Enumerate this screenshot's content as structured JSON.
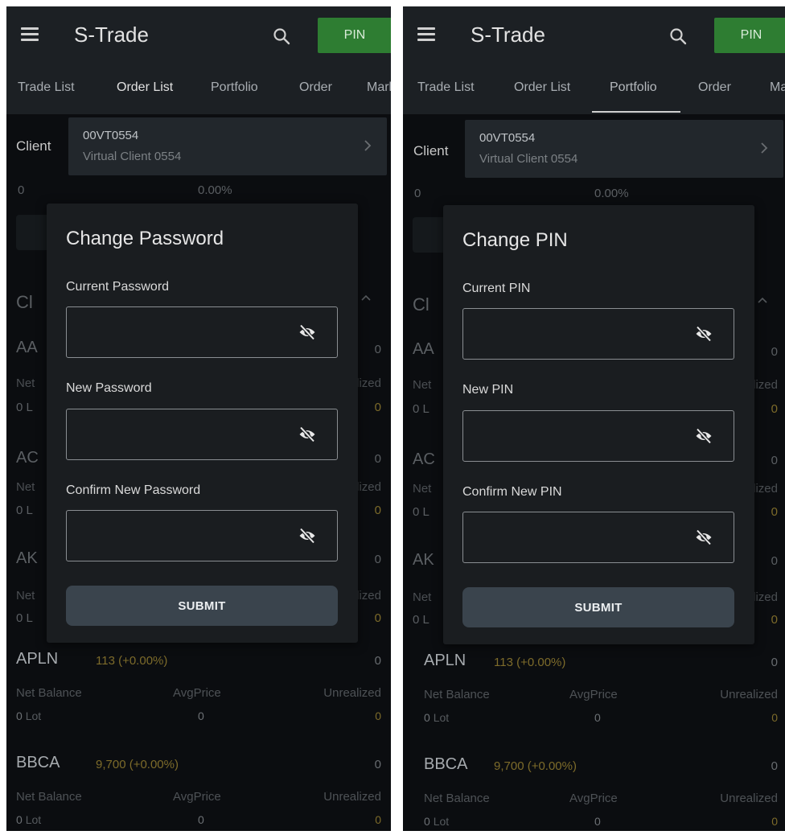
{
  "app": {
    "title": "S-Trade",
    "pin_label": "PIN",
    "menu_icon": "hamburger-menu-icon",
    "search_icon": "search-icon",
    "accent_green": "#2e7d32"
  },
  "tabs": [
    {
      "label": "Trade List"
    },
    {
      "label": "Order List"
    },
    {
      "label": "Portfolio"
    },
    {
      "label": "Order"
    },
    {
      "label": "Mark"
    }
  ],
  "tabs_right_last": "Ma",
  "client": {
    "label": "Client",
    "code": "00VT0554",
    "name": "Virtual Client 0554"
  },
  "background": {
    "summary_left": "0",
    "summary_pct": "0.00%",
    "section_initial": "Cl",
    "stocks": [
      {
        "sym": "AA",
        "right": "0",
        "col_a": "Net",
        "col_c": "Unrealized",
        "lot": "0 L",
        "unreal": "0"
      },
      {
        "sym": "AC",
        "right": "0",
        "col_a": "Net",
        "col_c": "Unrealized",
        "lot": "0 L",
        "unreal": "0"
      },
      {
        "sym": "AK",
        "right": "0",
        "col_a": "Net",
        "col_c": "Unrealized",
        "lot": "0 L",
        "unreal": "0"
      }
    ],
    "full_stocks": [
      {
        "sym": "APLN",
        "price": "113 (+0.00%)",
        "right": "0",
        "lbl_a": "Net Balance",
        "lbl_b": "AvgPrice",
        "lbl_c": "Unrealized",
        "lot_num": "0",
        "lot_unit": "Lot",
        "avg": "0",
        "unreal": "0"
      },
      {
        "sym": "BBCA",
        "price": "9,700 (+0.00%)",
        "right": "0",
        "lbl_a": "Net Balance",
        "lbl_b": "AvgPrice",
        "lbl_c": "Unrealized",
        "lot_num": "0",
        "lot_unit": "Lot",
        "avg": "0",
        "unreal": "0"
      }
    ]
  },
  "password_dialog": {
    "title": "Change Password",
    "fields": [
      {
        "label": "Current Password",
        "value": ""
      },
      {
        "label": "New Password",
        "value": ""
      },
      {
        "label": "Confirm New Password",
        "value": ""
      }
    ],
    "submit_label": "SUBMIT"
  },
  "pin_dialog": {
    "title": "Change PIN",
    "fields": [
      {
        "label": "Current PIN",
        "value": ""
      },
      {
        "label": "New PIN",
        "value": ""
      },
      {
        "label": "Confirm New PIN",
        "value": ""
      }
    ],
    "submit_label": "SUBMIT"
  },
  "icons": {
    "field_toggle": "eye-off-icon",
    "client_chevron": "chevron-right-icon",
    "section_chevron": "chevron-up-icon"
  }
}
